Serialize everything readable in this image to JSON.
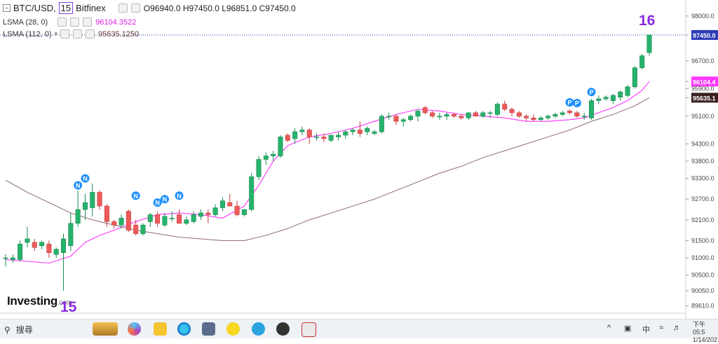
{
  "legend": {
    "symbol": "BTC/USD,",
    "interval": "15",
    "exchange": "Bitfinex",
    "ohlc": "O96940.0  H97450.0  L96851.0  C97450.0",
    "ma1_label": "LSMA (28, 0)",
    "ma1_value": "96104.3522",
    "ma2_label": "LSMA (112, 0)",
    "ma2_value": "95635.1250"
  },
  "watermark": {
    "brand": "Investing",
    "suffix": ".com"
  },
  "annotations": {
    "left": "15",
    "right": "16"
  },
  "colors": {
    "up": "#26b36b",
    "down": "#ee5a5a",
    "ma28": "#ff33ff",
    "ma112": "#9a7a7a",
    "last_price": "#2b3bb5",
    "annotation": "#8a2be2",
    "marker": "#1e90ff"
  },
  "taskbar": {
    "search_label": "搜尋",
    "ime_label": "中",
    "clock_time": "下午 05:5",
    "clock_date": "1/14/202"
  },
  "chart_data": {
    "type": "candlestick",
    "ylim": [
      89400,
      98300
    ],
    "y_ticks": [
      "98000.0",
      "97450.0",
      "96700.0",
      "96104.4",
      "95900.0",
      "95635.1",
      "95100.0",
      "94300.0",
      "93800.0",
      "93300.0",
      "92700.0",
      "92100.0",
      "91500.0",
      "91000.0",
      "90500.0",
      "90050.0",
      "89610.0"
    ],
    "y_tick_values": [
      98000,
      97450,
      96700,
      96104.4,
      95900,
      95635.1,
      95100,
      94300,
      93800,
      93300,
      92700,
      92100,
      91500,
      91000,
      90500,
      90050,
      89610
    ],
    "highlighted_ticks": [
      {
        "value": 97450,
        "label": "97450.0",
        "color": "#2b3bb5"
      },
      {
        "value": 96104.4,
        "label": "96104.4",
        "color": "#ff33ff"
      },
      {
        "value": 95635.1,
        "label": "95635.1",
        "color": "#3a1f1f"
      }
    ],
    "candles": [
      {
        "o": 91000,
        "h": 91100,
        "l": 90750,
        "c": 91000
      },
      {
        "o": 90950,
        "h": 91100,
        "l": 90850,
        "c": 91000
      },
      {
        "o": 90950,
        "h": 91500,
        "l": 90900,
        "c": 91400
      },
      {
        "o": 91450,
        "h": 91900,
        "l": 91300,
        "c": 91550
      },
      {
        "o": 91450,
        "h": 91550,
        "l": 91200,
        "c": 91300
      },
      {
        "o": 91350,
        "h": 91500,
        "l": 91250,
        "c": 91450
      },
      {
        "o": 91400,
        "h": 91500,
        "l": 91000,
        "c": 91150
      },
      {
        "o": 91100,
        "h": 91300,
        "l": 91000,
        "c": 91250
      },
      {
        "o": 91150,
        "h": 91700,
        "l": 90050,
        "c": 91550
      },
      {
        "o": 91350,
        "h": 92300,
        "l": 91200,
        "c": 92000
      },
      {
        "o": 92000,
        "h": 92950,
        "l": 91900,
        "c": 92400
      },
      {
        "o": 92400,
        "h": 92850,
        "l": 92100,
        "c": 92600
      },
      {
        "o": 92450,
        "h": 93150,
        "l": 92200,
        "c": 92900
      },
      {
        "o": 92900,
        "h": 92950,
        "l": 92400,
        "c": 92500
      },
      {
        "o": 92500,
        "h": 92550,
        "l": 91900,
        "c": 92050
      },
      {
        "o": 92050,
        "h": 92100,
        "l": 91850,
        "c": 91950
      },
      {
        "o": 91950,
        "h": 92250,
        "l": 91850,
        "c": 92150
      },
      {
        "o": 92350,
        "h": 92400,
        "l": 91750,
        "c": 91800
      },
      {
        "o": 91950,
        "h": 92100,
        "l": 91650,
        "c": 91700
      },
      {
        "o": 91700,
        "h": 92000,
        "l": 91650,
        "c": 91950
      },
      {
        "o": 92050,
        "h": 92300,
        "l": 91900,
        "c": 92250
      },
      {
        "o": 92250,
        "h": 92350,
        "l": 91900,
        "c": 92000
      },
      {
        "o": 91950,
        "h": 92300,
        "l": 91900,
        "c": 92200
      },
      {
        "o": 92150,
        "h": 92350,
        "l": 92050,
        "c": 92150
      },
      {
        "o": 92250,
        "h": 92400,
        "l": 92000,
        "c": 92000
      },
      {
        "o": 92000,
        "h": 92200,
        "l": 91950,
        "c": 92100
      },
      {
        "o": 92050,
        "h": 92350,
        "l": 92000,
        "c": 92250
      },
      {
        "o": 92200,
        "h": 92400,
        "l": 92100,
        "c": 92300
      },
      {
        "o": 92300,
        "h": 92400,
        "l": 92000,
        "c": 92250
      },
      {
        "o": 92250,
        "h": 92550,
        "l": 92200,
        "c": 92450
      },
      {
        "o": 92450,
        "h": 92750,
        "l": 92350,
        "c": 92650
      },
      {
        "o": 92600,
        "h": 92850,
        "l": 92500,
        "c": 92500
      },
      {
        "o": 92500,
        "h": 92650,
        "l": 92200,
        "c": 92250
      },
      {
        "o": 92250,
        "h": 92400,
        "l": 92200,
        "c": 92400
      },
      {
        "o": 92400,
        "h": 93450,
        "l": 92350,
        "c": 93350
      },
      {
        "o": 93350,
        "h": 93950,
        "l": 93250,
        "c": 93850
      },
      {
        "o": 93850,
        "h": 94050,
        "l": 93700,
        "c": 93950
      },
      {
        "o": 93950,
        "h": 94100,
        "l": 93800,
        "c": 94000
      },
      {
        "o": 93950,
        "h": 94550,
        "l": 93900,
        "c": 94500
      },
      {
        "o": 94550,
        "h": 94600,
        "l": 94350,
        "c": 94400
      },
      {
        "o": 94450,
        "h": 94750,
        "l": 94300,
        "c": 94650
      },
      {
        "o": 94650,
        "h": 94800,
        "l": 94550,
        "c": 94700
      },
      {
        "o": 94700,
        "h": 94750,
        "l": 94300,
        "c": 94500
      },
      {
        "o": 94500,
        "h": 94600,
        "l": 94400,
        "c": 94500
      },
      {
        "o": 94500,
        "h": 94600,
        "l": 94350,
        "c": 94450
      },
      {
        "o": 94400,
        "h": 94550,
        "l": 94350,
        "c": 94550
      },
      {
        "o": 94500,
        "h": 94650,
        "l": 94400,
        "c": 94550
      },
      {
        "o": 94550,
        "h": 94700,
        "l": 94450,
        "c": 94650
      },
      {
        "o": 94650,
        "h": 94750,
        "l": 94550,
        "c": 94700
      },
      {
        "o": 94700,
        "h": 94950,
        "l": 94500,
        "c": 94600
      },
      {
        "o": 94650,
        "h": 94800,
        "l": 94550,
        "c": 94750
      },
      {
        "o": 94600,
        "h": 94700,
        "l": 94550,
        "c": 94650
      },
      {
        "o": 94650,
        "h": 95150,
        "l": 94600,
        "c": 95100
      },
      {
        "o": 95100,
        "h": 95200,
        "l": 95000,
        "c": 95100
      },
      {
        "o": 95100,
        "h": 95150,
        "l": 94850,
        "c": 94950
      },
      {
        "o": 94950,
        "h": 95050,
        "l": 94800,
        "c": 95000
      },
      {
        "o": 95000,
        "h": 95150,
        "l": 94950,
        "c": 95100
      },
      {
        "o": 95100,
        "h": 95300,
        "l": 94950,
        "c": 95250
      },
      {
        "o": 95350,
        "h": 95400,
        "l": 95150,
        "c": 95200
      },
      {
        "o": 95200,
        "h": 95250,
        "l": 95050,
        "c": 95100
      },
      {
        "o": 95100,
        "h": 95200,
        "l": 95000,
        "c": 95100
      },
      {
        "o": 95100,
        "h": 95200,
        "l": 95000,
        "c": 95150
      },
      {
        "o": 95150,
        "h": 95200,
        "l": 95050,
        "c": 95100
      },
      {
        "o": 95100,
        "h": 95150,
        "l": 95000,
        "c": 95050
      },
      {
        "o": 95050,
        "h": 95200,
        "l": 95000,
        "c": 95200
      },
      {
        "o": 95200,
        "h": 95250,
        "l": 95100,
        "c": 95100
      },
      {
        "o": 95100,
        "h": 95250,
        "l": 95050,
        "c": 95200
      },
      {
        "o": 95200,
        "h": 95250,
        "l": 95050,
        "c": 95200
      },
      {
        "o": 95150,
        "h": 95500,
        "l": 95100,
        "c": 95450
      },
      {
        "o": 95450,
        "h": 95550,
        "l": 95250,
        "c": 95300
      },
      {
        "o": 95300,
        "h": 95350,
        "l": 95100,
        "c": 95200
      },
      {
        "o": 95200,
        "h": 95250,
        "l": 95050,
        "c": 95100
      },
      {
        "o": 95100,
        "h": 95150,
        "l": 94950,
        "c": 95050
      },
      {
        "o": 95050,
        "h": 95150,
        "l": 94950,
        "c": 95000
      },
      {
        "o": 95000,
        "h": 95100,
        "l": 94950,
        "c": 95050
      },
      {
        "o": 95050,
        "h": 95150,
        "l": 95000,
        "c": 95100
      },
      {
        "o": 95100,
        "h": 95200,
        "l": 95050,
        "c": 95150
      },
      {
        "o": 95150,
        "h": 95250,
        "l": 95100,
        "c": 95200
      },
      {
        "o": 95250,
        "h": 95300,
        "l": 95150,
        "c": 95200
      },
      {
        "o": 95200,
        "h": 95250,
        "l": 95050,
        "c": 95100
      },
      {
        "o": 95100,
        "h": 95200,
        "l": 95000,
        "c": 95100
      },
      {
        "o": 95050,
        "h": 95600,
        "l": 95000,
        "c": 95550
      },
      {
        "o": 95550,
        "h": 95700,
        "l": 95450,
        "c": 95600
      },
      {
        "o": 95600,
        "h": 95700,
        "l": 95550,
        "c": 95650
      },
      {
        "o": 95550,
        "h": 95750,
        "l": 95450,
        "c": 95700
      },
      {
        "o": 95650,
        "h": 95850,
        "l": 95550,
        "c": 95800
      },
      {
        "o": 95700,
        "h": 96000,
        "l": 95650,
        "c": 95950
      },
      {
        "o": 95950,
        "h": 96550,
        "l": 95900,
        "c": 96500
      },
      {
        "o": 96500,
        "h": 96900,
        "l": 96450,
        "c": 96850
      },
      {
        "o": 96940,
        "h": 97450,
        "l": 96851,
        "c": 97450
      }
    ],
    "markers": [
      {
        "index": 10,
        "label": "N",
        "price": 93100
      },
      {
        "index": 11,
        "label": "N",
        "price": 93300
      },
      {
        "index": 18,
        "label": "N",
        "price": 92800
      },
      {
        "index": 21,
        "label": "N",
        "price": 92600
      },
      {
        "index": 22,
        "label": "N",
        "price": 92700
      },
      {
        "index": 24,
        "label": "N",
        "price": 92800
      },
      {
        "index": 78,
        "label": "P",
        "price": 95500
      },
      {
        "index": 79,
        "label": "P",
        "price": 95480
      },
      {
        "index": 81,
        "label": "P",
        "price": 95800
      }
    ],
    "series": [
      {
        "name": "LSMA (28, 0)",
        "color": "#ff33ff",
        "values": [
          [
            0,
            90950
          ],
          [
            6,
            90850
          ],
          [
            9,
            91050
          ],
          [
            11,
            91450
          ],
          [
            13,
            91650
          ],
          [
            15,
            91800
          ],
          [
            18,
            92050
          ],
          [
            21,
            92250
          ],
          [
            24,
            92300
          ],
          [
            27,
            92250
          ],
          [
            30,
            92150
          ],
          [
            33,
            92500
          ],
          [
            35,
            93100
          ],
          [
            37,
            93800
          ],
          [
            39,
            94250
          ],
          [
            42,
            94500
          ],
          [
            45,
            94600
          ],
          [
            48,
            94750
          ],
          [
            51,
            94950
          ],
          [
            54,
            95150
          ],
          [
            57,
            95300
          ],
          [
            60,
            95250
          ],
          [
            63,
            95150
          ],
          [
            66,
            95100
          ],
          [
            69,
            95050
          ],
          [
            72,
            94950
          ],
          [
            75,
            94950
          ],
          [
            78,
            95000
          ],
          [
            80,
            95050
          ],
          [
            82,
            95200
          ],
          [
            84,
            95350
          ],
          [
            86,
            95550
          ],
          [
            88,
            95850
          ],
          [
            89,
            96104.4
          ]
        ]
      },
      {
        "name": "LSMA (112, 0)",
        "color": "#9a7a7a",
        "values": [
          [
            0,
            93250
          ],
          [
            3,
            92900
          ],
          [
            6,
            92600
          ],
          [
            9,
            92300
          ],
          [
            12,
            92100
          ],
          [
            15,
            91950
          ],
          [
            18,
            91800
          ],
          [
            21,
            91700
          ],
          [
            24,
            91600
          ],
          [
            27,
            91550
          ],
          [
            30,
            91500
          ],
          [
            33,
            91500
          ],
          [
            36,
            91650
          ],
          [
            39,
            91850
          ],
          [
            42,
            92100
          ],
          [
            45,
            92300
          ],
          [
            48,
            92500
          ],
          [
            51,
            92700
          ],
          [
            54,
            92950
          ],
          [
            57,
            93200
          ],
          [
            60,
            93450
          ],
          [
            63,
            93650
          ],
          [
            66,
            93900
          ],
          [
            69,
            94100
          ],
          [
            72,
            94300
          ],
          [
            75,
            94500
          ],
          [
            78,
            94700
          ],
          [
            81,
            94950
          ],
          [
            84,
            95150
          ],
          [
            87,
            95400
          ],
          [
            89,
            95635.1
          ]
        ]
      }
    ],
    "last_price": 97450,
    "grid": false
  }
}
